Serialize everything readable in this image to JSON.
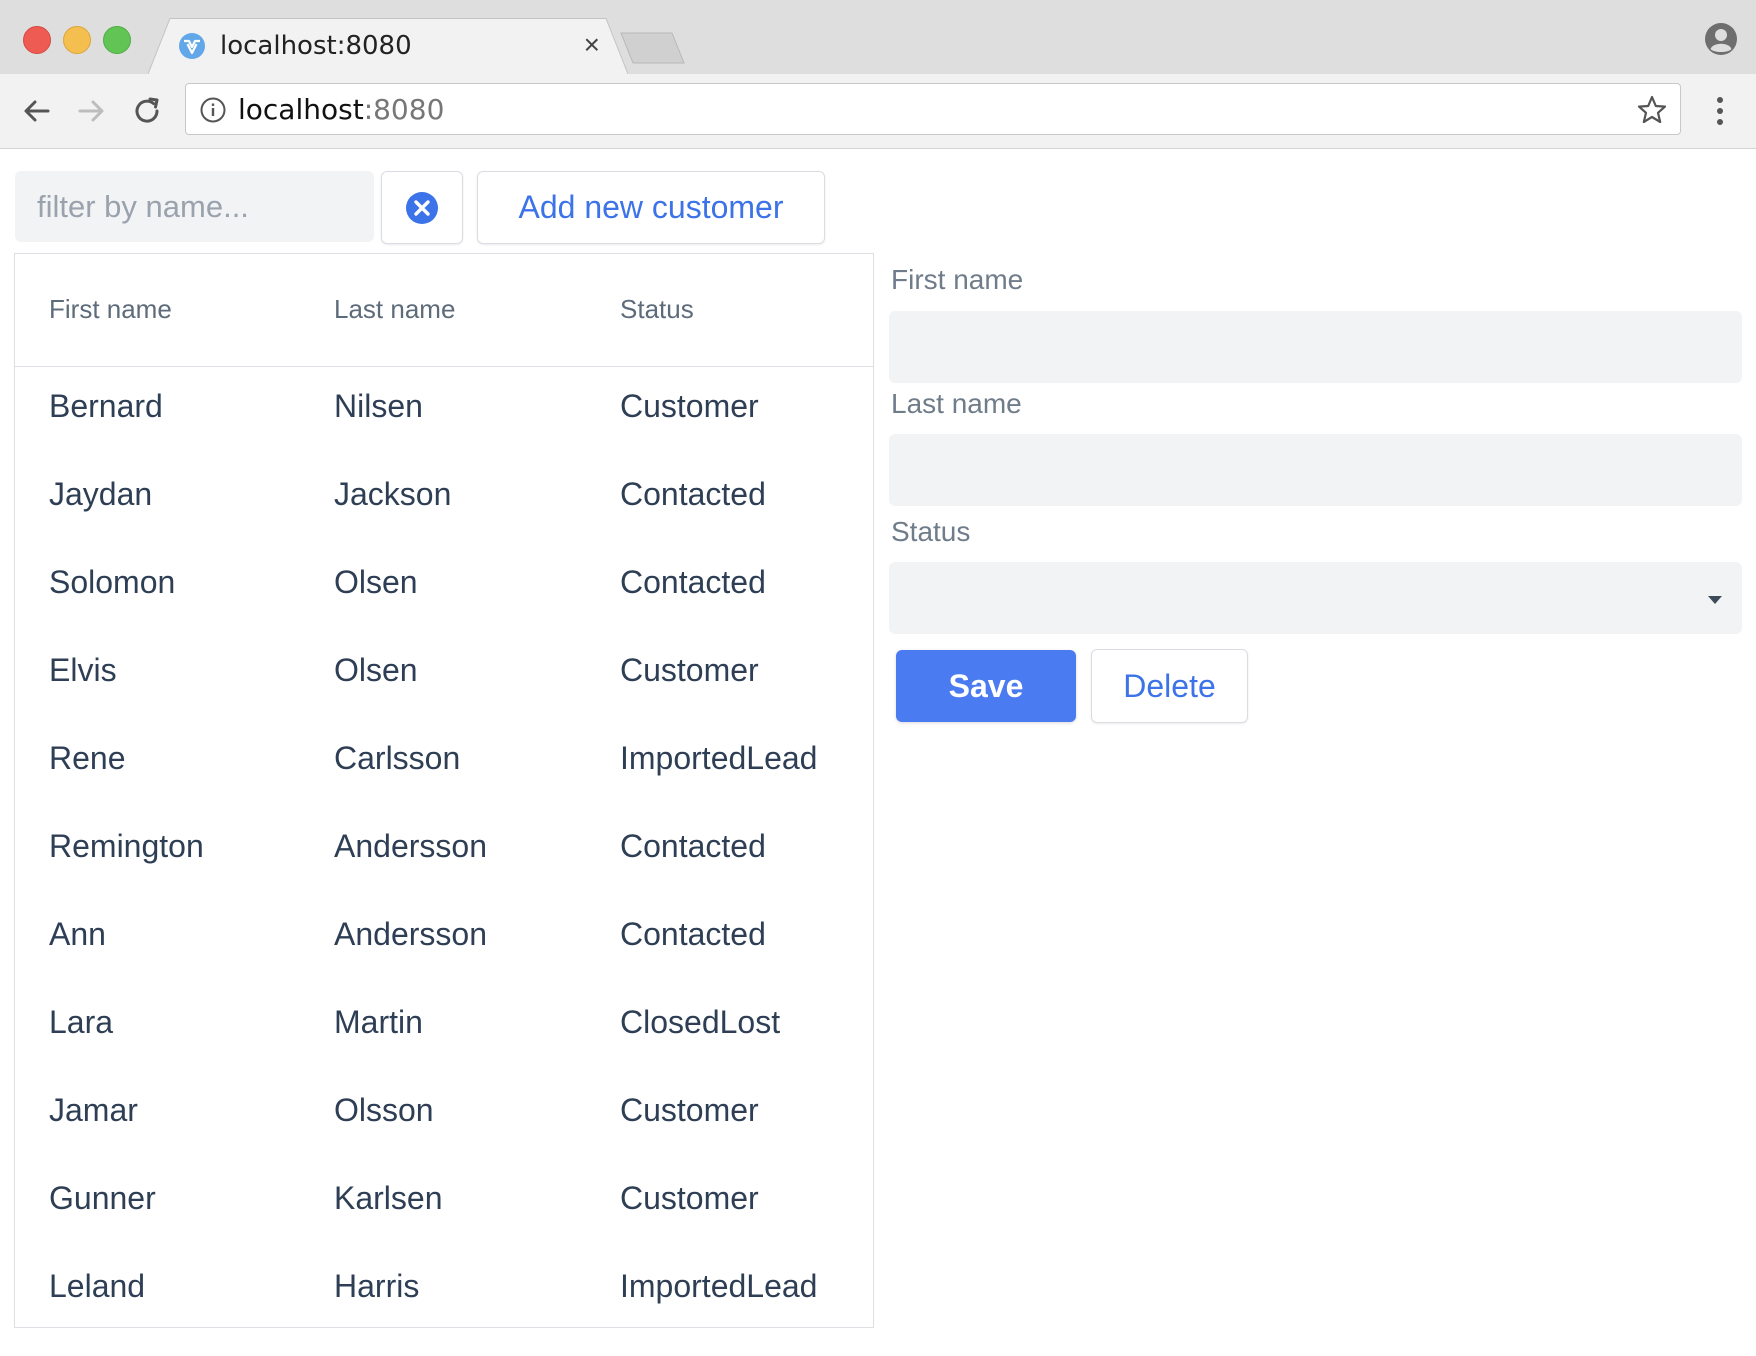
{
  "browser": {
    "tab_title": "localhost:8080",
    "tab_close": "×",
    "url_host": "localhost",
    "url_port": ":8080",
    "icons": {
      "favicon": "vaadin-favicon-icon",
      "back": "arrow-left-icon",
      "forward": "arrow-right-icon",
      "reload": "reload-icon",
      "info": "info-icon",
      "bookmark": "star-icon",
      "menu": "kebab-menu-icon",
      "profile": "profile-icon"
    }
  },
  "toolbar": {
    "filter_placeholder": "filter by name...",
    "filter_value": "",
    "clear_icon": "clear-circle-icon",
    "add_label": "Add new customer"
  },
  "grid": {
    "columns": [
      "First name",
      "Last name",
      "Status"
    ],
    "rows": [
      [
        "Bernard",
        "Nilsen",
        "Customer"
      ],
      [
        "Jaydan",
        "Jackson",
        "Contacted"
      ],
      [
        "Solomon",
        "Olsen",
        "Contacted"
      ],
      [
        "Elvis",
        "Olsen",
        "Customer"
      ],
      [
        "Rene",
        "Carlsson",
        "ImportedLead"
      ],
      [
        "Remington",
        "Andersson",
        "Contacted"
      ],
      [
        "Ann",
        "Andersson",
        "Contacted"
      ],
      [
        "Lara",
        "Martin",
        "ClosedLost"
      ],
      [
        "Jamar",
        "Olsson",
        "Customer"
      ],
      [
        "Gunner",
        "Karlsen",
        "Customer"
      ],
      [
        "Leland",
        "Harris",
        "ImportedLead"
      ]
    ]
  },
  "form": {
    "first_name_label": "First name",
    "first_name_value": "",
    "last_name_label": "Last name",
    "last_name_value": "",
    "status_label": "Status",
    "status_value": "",
    "save_label": "Save",
    "delete_label": "Delete"
  },
  "colors": {
    "accent": "#4b7bf0",
    "link": "#3d73e8",
    "field_bg": "#f2f3f5",
    "border": "#dcdfe4"
  }
}
